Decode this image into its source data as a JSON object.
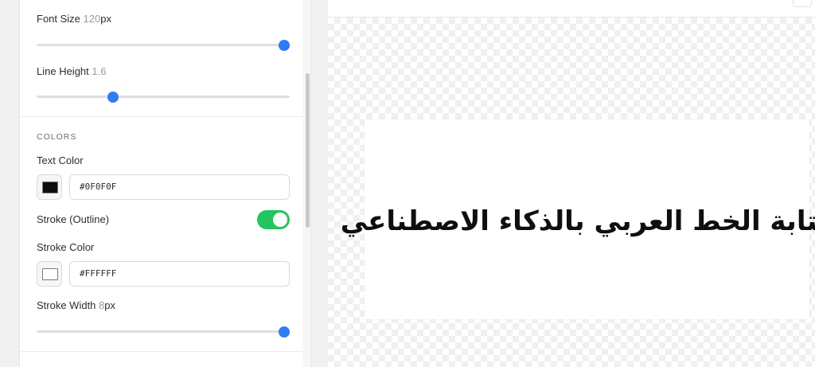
{
  "panel": {
    "font_size": {
      "label": "Font Size",
      "value": "120",
      "unit": "px",
      "slider_fraction": 1.0
    },
    "line_height": {
      "label": "Line Height",
      "value": "1.6",
      "slider_fraction": 0.31
    },
    "colors_title": "COLORS",
    "text_color": {
      "label": "Text Color",
      "hex": "#0F0F0F",
      "swatch": "#0F0F0F"
    },
    "stroke_toggle": {
      "label": "Stroke (Outline)",
      "enabled": true,
      "color": "#22c55e"
    },
    "stroke_color": {
      "label": "Stroke Color",
      "hex": "#FFFFFF",
      "swatch": "#FFFFFF"
    },
    "stroke_width": {
      "label": "Stroke Width",
      "value": "8",
      "unit": "px",
      "slider_fraction": 1.0
    }
  },
  "accent_color": "#2f7cf6",
  "preview": {
    "text": "كتابة الخط العربي بالذكاء الاصطناعي"
  }
}
